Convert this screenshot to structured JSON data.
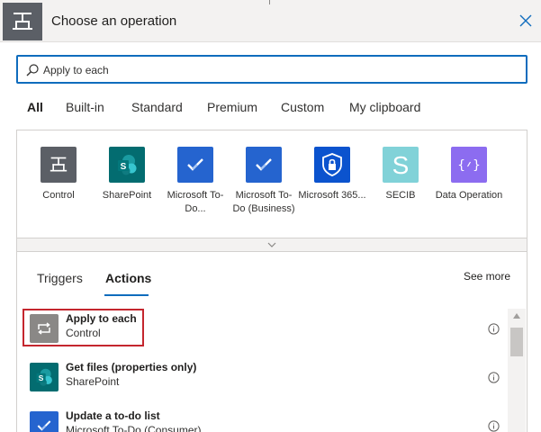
{
  "header": {
    "title": "Choose an operation",
    "icon": "control-icon",
    "close_icon": "close-icon"
  },
  "search": {
    "icon": "search-icon",
    "value": "Apply to each"
  },
  "tabs": [
    {
      "label": "All",
      "active": true
    },
    {
      "label": "Built-in",
      "active": false
    },
    {
      "label": "Standard",
      "active": false
    },
    {
      "label": "Premium",
      "active": false
    },
    {
      "label": "Custom",
      "active": false
    },
    {
      "label": "My clipboard",
      "active": false
    }
  ],
  "connectors": [
    {
      "label": "Control",
      "icon": "control-icon",
      "color": "#5b5f66"
    },
    {
      "label": "SharePoint",
      "icon": "sharepoint-icon",
      "color": "#036c70"
    },
    {
      "label": "Microsoft To-Do...",
      "icon": "todo-check-icon",
      "color": "#2564cf"
    },
    {
      "label": "Microsoft To-Do (Business)",
      "icon": "todo-check-icon",
      "color": "#2564cf"
    },
    {
      "label": "Microsoft 365...",
      "icon": "shield-lock-icon",
      "color": "#0b53ce"
    },
    {
      "label": "SECIB",
      "icon": "secib-icon",
      "color": "#81d2d8"
    },
    {
      "label": "Data Operation",
      "icon": "data-operation-icon",
      "color": "#8c6cf0"
    }
  ],
  "expander": {
    "icon": "chevron-down-icon"
  },
  "subtabs": [
    {
      "label": "Triggers",
      "active": false
    },
    {
      "label": "Actions",
      "active": true
    }
  ],
  "see_more": "See more",
  "actions": [
    {
      "title": "Apply to each",
      "connector": "Control",
      "icon": "loop-icon",
      "color": "#8a8886",
      "highlighted": true
    },
    {
      "title": "Get files (properties only)",
      "connector": "SharePoint",
      "icon": "sharepoint-icon",
      "color": "#036c70",
      "highlighted": false
    },
    {
      "title": "Update a to-do list",
      "connector": "Microsoft To-Do (Consumer)",
      "icon": "todo-check-icon",
      "color": "#2564cf",
      "highlighted": false
    }
  ],
  "colors": {
    "accent": "#0f6cbd",
    "highlight": "#c4262e"
  }
}
